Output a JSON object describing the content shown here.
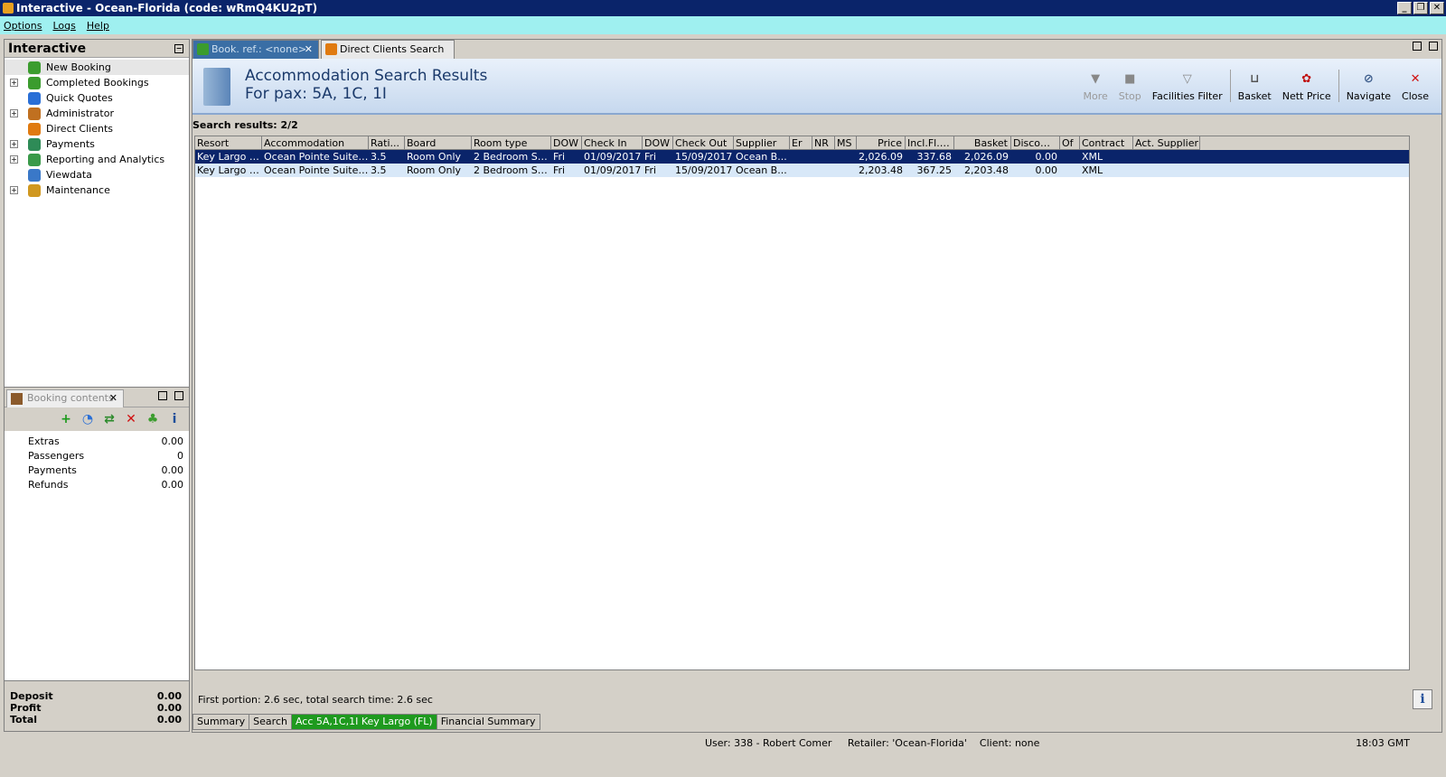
{
  "window": {
    "title": "Interactive - Ocean-Florida (code: wRmQ4KU2pT)",
    "buttons": [
      "_",
      "❐",
      "✕"
    ]
  },
  "menu": [
    "Options",
    "Logs",
    "Help"
  ],
  "leftnav": {
    "title": "Interactive",
    "items": [
      {
        "label": "New Booking",
        "expandable": false,
        "icon": "palm-tree-icon",
        "color": "#3b9c2e"
      },
      {
        "label": "Completed Bookings",
        "expandable": true,
        "icon": "palm-tree-icon",
        "color": "#3b9c2e"
      },
      {
        "label": "Quick Quotes",
        "expandable": false,
        "icon": "clock-icon",
        "color": "#2a6fd6"
      },
      {
        "label": "Administrator",
        "expandable": true,
        "icon": "admin-icon",
        "color": "#c07020"
      },
      {
        "label": "Direct Clients",
        "expandable": false,
        "icon": "people-icon",
        "color": "#e07a10"
      },
      {
        "label": "Payments",
        "expandable": true,
        "icon": "payments-icon",
        "color": "#2e8b57"
      },
      {
        "label": "Reporting and Analytics",
        "expandable": true,
        "icon": "report-icon",
        "color": "#3a9a4a"
      },
      {
        "label": "Viewdata",
        "expandable": false,
        "icon": "globe-icon",
        "color": "#3a78c8"
      },
      {
        "label": "Maintenance",
        "expandable": true,
        "icon": "maintenance-icon",
        "color": "#d09820"
      }
    ]
  },
  "booking": {
    "tab": "Booking contents",
    "rows": [
      {
        "label": "Extras",
        "value": "0.00"
      },
      {
        "label": "Passengers",
        "value": "0"
      },
      {
        "label": "Payments",
        "value": "0.00"
      },
      {
        "label": "Refunds",
        "value": "0.00"
      }
    ],
    "footer": [
      {
        "label": "Deposit",
        "value": "0.00"
      },
      {
        "label": "Profit",
        "value": "0.00"
      },
      {
        "label": "Total",
        "value": "0.00"
      }
    ],
    "tools": [
      {
        "icon": "add-icon",
        "glyph": "+",
        "color": "#1a9a1a"
      },
      {
        "icon": "clock-icon",
        "glyph": "◔",
        "color": "#2a6fd6"
      },
      {
        "icon": "transfer-icon",
        "glyph": "⇄",
        "color": "#2a8a2a"
      },
      {
        "icon": "delete-icon",
        "glyph": "✕",
        "color": "#d01010"
      },
      {
        "icon": "palm-tree-icon",
        "glyph": "♣",
        "color": "#3b9c2e"
      },
      {
        "icon": "info-icon",
        "glyph": "i",
        "color": "#1d4e9a"
      }
    ]
  },
  "tabs": [
    {
      "label": "Book. ref.: <none>",
      "active": true
    },
    {
      "label": "Direct Clients Search",
      "active": false
    }
  ],
  "results": {
    "title": "Accommodation Search Results",
    "subtitle": "For pax: 5A, 1C, 1I",
    "count_label": "Search results: 2/2",
    "toolbar": [
      {
        "label": "More",
        "icon": "more-icon",
        "glyph": "▼",
        "disabled": true
      },
      {
        "label": "Stop",
        "icon": "stop-icon",
        "glyph": "■",
        "disabled": true
      },
      {
        "label": "Facilities Filter",
        "icon": "filter-icon",
        "glyph": "▽",
        "disabled": false
      },
      {
        "sep": true
      },
      {
        "label": "Basket",
        "icon": "basket-icon",
        "glyph": "⊔",
        "disabled": false
      },
      {
        "label": "Nett Price",
        "icon": "nett-price-icon",
        "glyph": "✿",
        "disabled": false
      },
      {
        "sep": true
      },
      {
        "label": "Navigate",
        "icon": "navigate-icon",
        "glyph": "⊘",
        "disabled": false
      },
      {
        "label": "Close",
        "icon": "close-icon",
        "glyph": "✕",
        "disabled": false
      }
    ],
    "columns": [
      "Resort",
      "Accommodation",
      "Rati...",
      "Board",
      "Room type",
      "DOW",
      "Check In",
      "DOW",
      "Check Out",
      "Supplier",
      "Er",
      "NR",
      "MS",
      "Price",
      "Incl.Fl.PP",
      "Basket",
      "Discount",
      "Of",
      "Contract",
      "Act. Supplier"
    ],
    "rows": [
      [
        "Key Largo (...",
        "Ocean Pointe Suites ...",
        "3.5",
        "Room Only",
        "2 Bedroom Suit...",
        "Fri",
        "01/09/2017",
        "Fri",
        "15/09/2017",
        "Ocean B...",
        "",
        "",
        "",
        "2,026.09",
        "337.68",
        "2,026.09",
        "0.00",
        "",
        "XML",
        ""
      ],
      [
        "Key Largo (...",
        "Ocean Pointe Suites ...",
        "3.5",
        "Room Only",
        "2 Bedroom Suit...",
        "Fri",
        "01/09/2017",
        "Fri",
        "15/09/2017",
        "Ocean B...",
        "",
        "",
        "",
        "2,203.48",
        "367.25",
        "2,203.48",
        "0.00",
        "",
        "XML",
        ""
      ]
    ],
    "status": "First portion: 2.6 sec, total search time: 2.6 sec"
  },
  "bottom_tabs": [
    {
      "label": "Summary",
      "active": false
    },
    {
      "label": "Search",
      "active": false
    },
    {
      "label": "Acc 5A,1C,1I Key Largo (FL)",
      "active": true
    },
    {
      "label": "Financial Summary",
      "active": false
    }
  ],
  "statusbar": {
    "user": "User: 338 - Robert Comer",
    "retailer": "Retailer: 'Ocean-Florida'",
    "client": "Client: none",
    "time": "18:03 GMT"
  }
}
